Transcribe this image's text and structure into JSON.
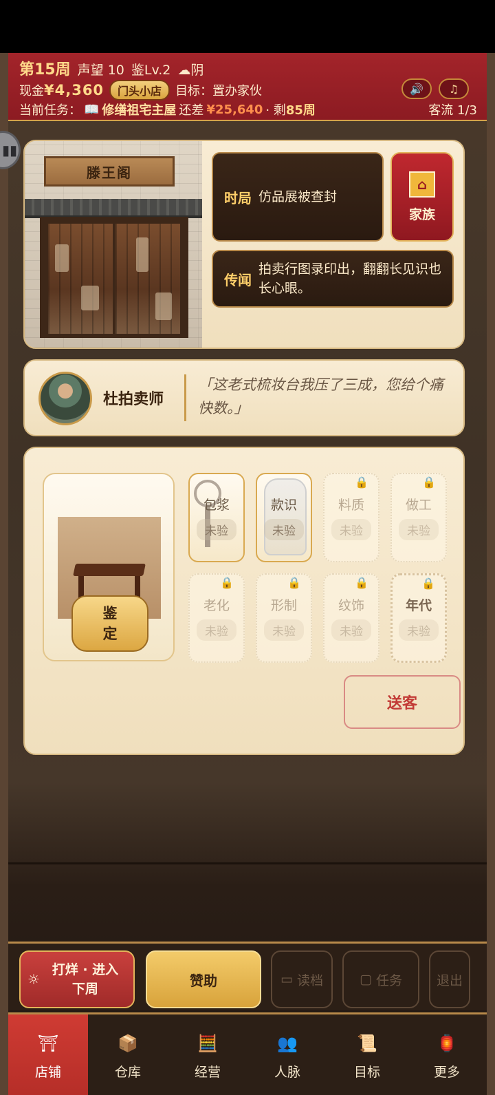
{
  "header": {
    "week": "第15周",
    "reputation_label": "声望",
    "reputation_value": "10",
    "appraisal_level": "鉴Lv.2",
    "weather_icon": "☁",
    "weather": "阴",
    "cash_label": "现金",
    "cash_value": "¥4,360",
    "shop_badge": "门头小店",
    "goal_label": "目标：",
    "goal_value": "置办家伙",
    "task_label": "当前任务：",
    "task_icon": "📖",
    "task_name": "修缮祖宅主屋",
    "owe_label": "还差",
    "owe_value": "¥25,640",
    "weeks_sep": "· 剩",
    "weeks_left": "85周",
    "customer_flow": "客流 1/3",
    "sound_icon": "🔊",
    "music_icon": "♫"
  },
  "shop": {
    "sign": "滕王阁"
  },
  "news": {
    "situation_tag": "时局",
    "situation_text": "仿品展被查封",
    "rumor_tag": "传闻",
    "rumor_text": "拍卖行图录印出，翻翻长见识也长心眼。"
  },
  "family": {
    "label": "家族"
  },
  "npc": {
    "name": "杜拍卖师",
    "quote": "「这老式梳妆台我压了三成，您给个痛快数。」"
  },
  "appraisal": {
    "identify_label": "鉴\n定",
    "identify_line1": "鉴",
    "identify_line2": "定",
    "send_label": "送客",
    "attributes": [
      {
        "label": "包浆",
        "status": "未验"
      },
      {
        "label": "款识",
        "status": "未验"
      },
      {
        "label": "料质",
        "status": "未验"
      },
      {
        "label": "做工",
        "status": "未验"
      },
      {
        "label": "老化",
        "status": "未验"
      },
      {
        "label": "形制",
        "status": "未验"
      },
      {
        "label": "纹饰",
        "status": "未验"
      },
      {
        "label": "年代",
        "status": "未验"
      }
    ]
  },
  "actions": {
    "next_week": "打烊 · 进入下周",
    "next_line1": "打烊 · 进入",
    "next_line2": "下周",
    "sponsor": "赞助",
    "load": "读档",
    "tasks": "任务",
    "exit": "退出"
  },
  "tabs": [
    {
      "label": "店铺",
      "icon": "shop-icon"
    },
    {
      "label": "仓库",
      "icon": "warehouse-icon"
    },
    {
      "label": "经营",
      "icon": "business-icon"
    },
    {
      "label": "人脉",
      "icon": "contacts-icon"
    },
    {
      "label": "目标",
      "icon": "goal-icon"
    },
    {
      "label": "更多",
      "icon": "more-icon"
    }
  ],
  "colors": {
    "header_red": "#a3242a",
    "gold": "#d9a43e",
    "parchment": "#f3e6c8",
    "active_tab": "#cf3b33"
  }
}
